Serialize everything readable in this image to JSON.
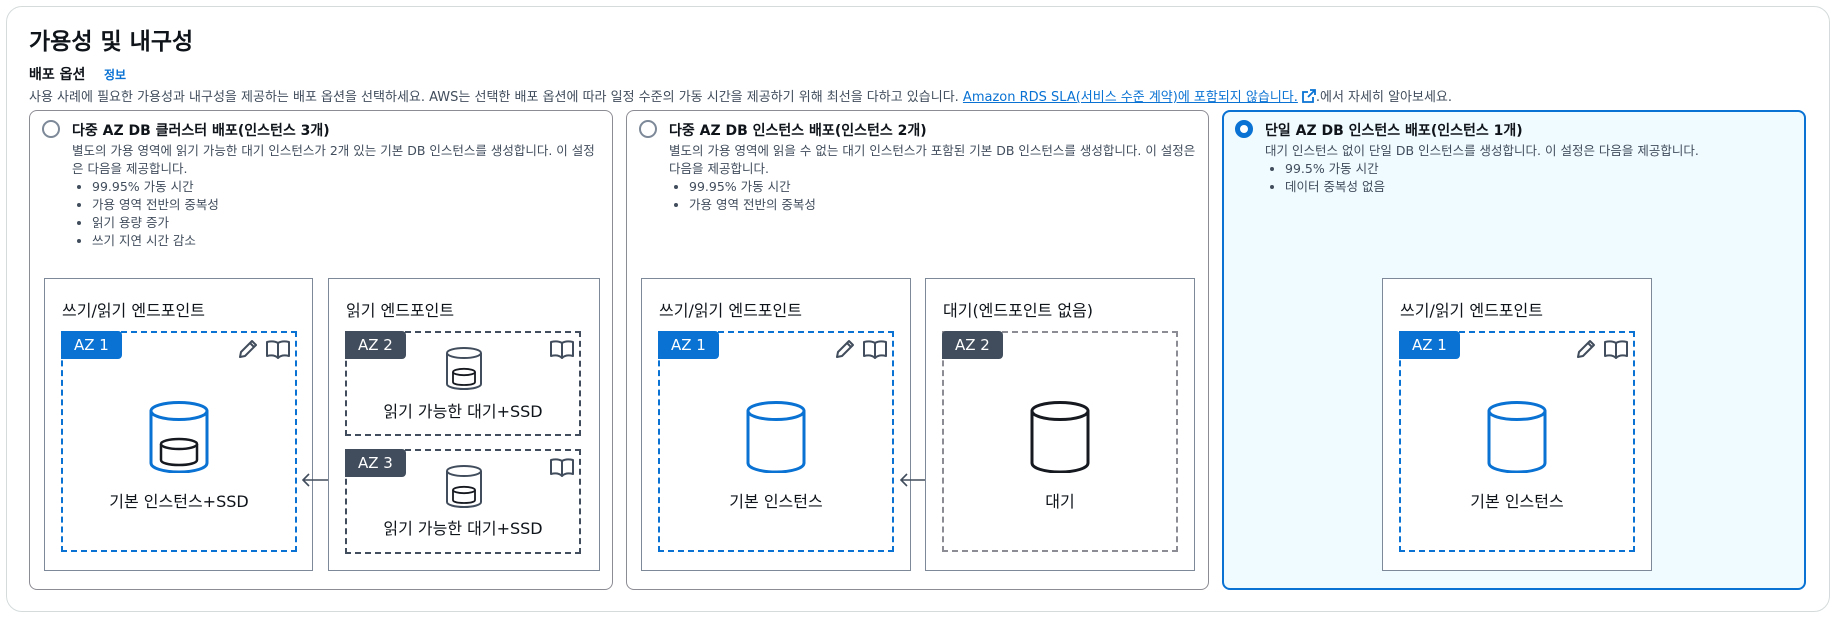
{
  "section": {
    "title": "가용성 및 내구성",
    "label": "배포 옵션",
    "info": "정보",
    "desc_before": "사용 사례에 필요한 가용성과 내구성을 제공하는 배포 옵션을 선택하세요. AWS는 선택한 배포 옵션에 따라 일정 수준의 가동 시간을 제공하기 위해 최선을 다하고 있습니다. ",
    "desc_link": "Amazon RDS SLA(서비스 수준 계약)에 포함되지 않습니다.",
    "desc_after": ".에서 자세히 알아보세요."
  },
  "options": [
    {
      "title": "다중 AZ DB 클러스터 배포(인스턴스 3개)",
      "selected": false,
      "desc": "별도의 가용 영역에 읽기 가능한 대기 인스턴스가 2개 있는 기본 DB 인스턴스를 생성합니다. 이 설정은 다음을 제공합니다.",
      "bullets": [
        "99.95% 가동 시간",
        "가용 영역 전반의 중복성",
        "읽기 용량 증가",
        "쓰기 지연 시간 감소"
      ],
      "boxes": [
        {
          "title": "쓰기/읽기 엔드포인트",
          "zones": [
            {
              "badge": "AZ 1",
              "label": "기본 인스턴스+SSD"
            }
          ]
        },
        {
          "title": "읽기 엔드포인트",
          "zones": [
            {
              "badge": "AZ 2",
              "label": "읽기 가능한 대기+SSD"
            },
            {
              "badge": "AZ 3",
              "label": "읽기 가능한 대기+SSD"
            }
          ]
        }
      ]
    },
    {
      "title": "다중 AZ DB 인스턴스 배포(인스턴스 2개)",
      "selected": false,
      "desc": "별도의 가용 영역에 읽을 수 없는 대기 인스턴스가 포함된 기본 DB 인스턴스를 생성합니다. 이 설정은 다음을 제공합니다.",
      "bullets": [
        "99.95% 가동 시간",
        "가용 영역 전반의 중복성"
      ],
      "boxes": [
        {
          "title": "쓰기/읽기 엔드포인트",
          "zones": [
            {
              "badge": "AZ 1",
              "label": "기본 인스턴스"
            }
          ]
        },
        {
          "title": "대기(엔드포인트 없음)",
          "zones": [
            {
              "badge": "AZ 2",
              "label": "대기"
            }
          ]
        }
      ]
    },
    {
      "title": "단일 AZ DB 인스턴스 배포(인스턴스 1개)",
      "selected": true,
      "desc": "대기 인스턴스 없이 단일 DB 인스턴스를 생성합니다. 이 설정은 다음을 제공합니다.",
      "bullets": [
        "99.5% 가동 시간",
        "데이터 중복성 없음"
      ],
      "boxes": [
        {
          "title": "쓰기/읽기 엔드포인트",
          "zones": [
            {
              "badge": "AZ 1",
              "label": "기본 인스턴스"
            }
          ]
        }
      ]
    }
  ],
  "colors": {
    "accent": "#0972d3",
    "dark_badge": "#414d5c",
    "selected_bg": "#f0fbff"
  },
  "icons": [
    "edit-icon",
    "book-icon",
    "database-icon",
    "external-link-icon",
    "bidirectional-arrow-icon"
  ]
}
